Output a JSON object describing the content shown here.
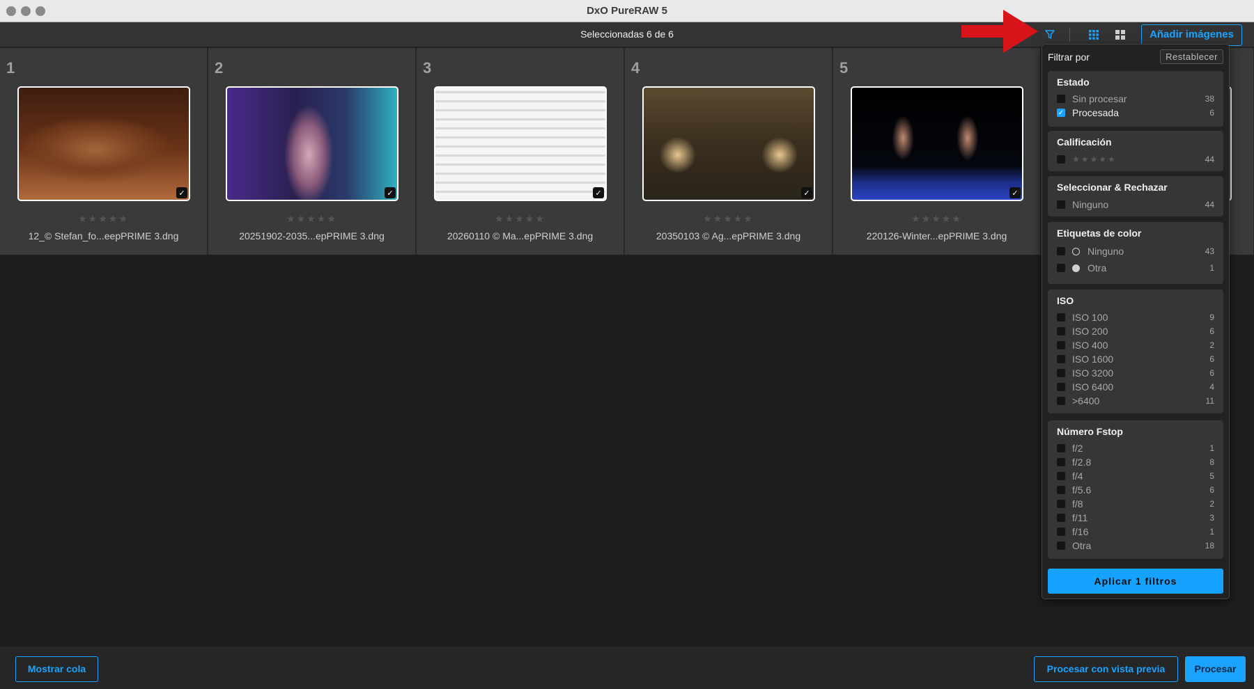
{
  "window": {
    "title": "DxO PureRAW 5"
  },
  "toolbar": {
    "selection_text": "Seleccionadas 6 de 6",
    "add_images_label": "Añadir imágenes",
    "accent_color": "#1ba3ff"
  },
  "thumbnails": [
    {
      "number": "1",
      "filename": "12_© Stefan_fo...eepPRIME 3.dng",
      "stars": "★★★★★"
    },
    {
      "number": "2",
      "filename": "20251902-2035...epPRIME 3.dng",
      "stars": "★★★★★"
    },
    {
      "number": "3",
      "filename": "20260110 © Ma...epPRIME 3.dng",
      "stars": "★★★★★"
    },
    {
      "number": "4",
      "filename": "20350103 © Ag...epPRIME 3.dng",
      "stars": "★★★★★"
    },
    {
      "number": "5",
      "filename": "220126-Winter...epPRIME 3.dng",
      "stars": "★★★★★"
    }
  ],
  "filter_panel": {
    "title": "Filtrar por",
    "reset_label": "Restablecer",
    "estado": {
      "title": "Estado",
      "items": [
        {
          "label": "Sin procesar",
          "count": "38"
        },
        {
          "label": "Procesada",
          "count": "6"
        }
      ]
    },
    "calificacion": {
      "title": "Calificación",
      "items": [
        {
          "label": "★★★★★",
          "count": "44"
        }
      ]
    },
    "seleccionar": {
      "title": "Seleccionar & Rechazar",
      "items": [
        {
          "label": "Ninguno",
          "count": "44"
        }
      ]
    },
    "etiquetas": {
      "title": "Etiquetas de color",
      "items": [
        {
          "label": "Ninguno",
          "count": "43"
        },
        {
          "label": "Otra",
          "count": "1"
        }
      ]
    },
    "iso": {
      "title": "ISO",
      "items": [
        {
          "label": "ISO 100",
          "count": "9"
        },
        {
          "label": "ISO 200",
          "count": "6"
        },
        {
          "label": "ISO 400",
          "count": "2"
        },
        {
          "label": "ISO 1600",
          "count": "6"
        },
        {
          "label": "ISO 3200",
          "count": "6"
        },
        {
          "label": "ISO 6400",
          "count": "4"
        },
        {
          "label": ">6400",
          "count": "11"
        }
      ]
    },
    "fstop": {
      "title": "Número Fstop",
      "items": [
        {
          "label": "f/2",
          "count": "1"
        },
        {
          "label": "f/2.8",
          "count": "8"
        },
        {
          "label": "f/4",
          "count": "5"
        },
        {
          "label": "f/5.6",
          "count": "6"
        },
        {
          "label": "f/8",
          "count": "2"
        },
        {
          "label": "f/11",
          "count": "3"
        },
        {
          "label": "f/16",
          "count": "1"
        },
        {
          "label": "Otra",
          "count": "18"
        }
      ]
    },
    "apply_label": "Aplicar 1 filtros"
  },
  "bottombar": {
    "show_queue_label": "Mostrar cola",
    "process_preview_label": "Procesar con vista previa",
    "process_label": "Procesar"
  }
}
